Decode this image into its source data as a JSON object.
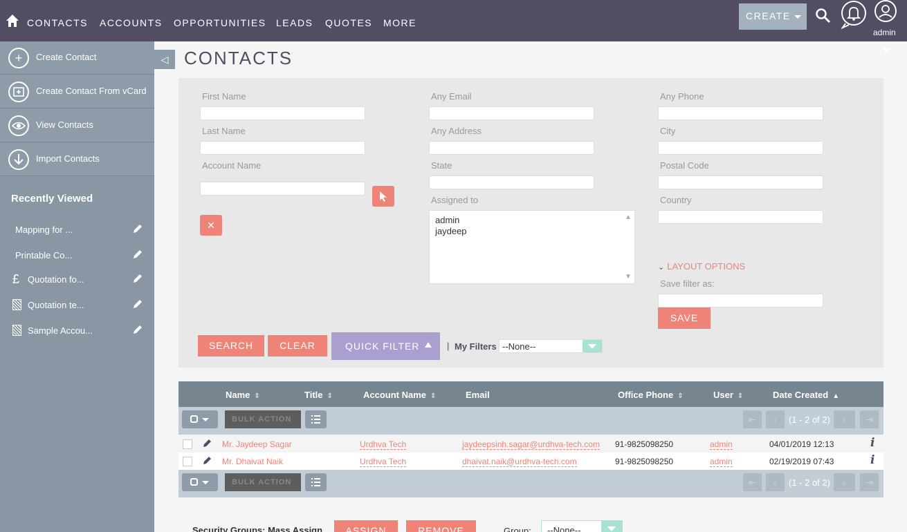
{
  "topnav": {
    "items": [
      "CONTACTS",
      "ACCOUNTS",
      "OPPORTUNITIES",
      "LEADS",
      "QUOTES",
      "MORE"
    ],
    "create_label": "CREATE",
    "user_label": "admin"
  },
  "sidebar": {
    "actions": [
      {
        "label": "Create Contact",
        "icon": "plus-circle-icon"
      },
      {
        "label": "Create Contact From vCard",
        "icon": "vcard-icon"
      },
      {
        "label": "View Contacts",
        "icon": "eye-icon"
      },
      {
        "label": "Import Contacts",
        "icon": "download-icon"
      }
    ],
    "recent_title": "Recently Viewed",
    "recent_items": [
      {
        "label": "Mapping for ...",
        "icon": "none"
      },
      {
        "label": "Printable Co...",
        "icon": "none"
      },
      {
        "label": "Quotation fo...",
        "icon": "pound-icon"
      },
      {
        "label": "Quotation te...",
        "icon": "document-icon"
      },
      {
        "label": "Sample Accou...",
        "icon": "document-icon"
      }
    ]
  },
  "page": {
    "title": "CONTACTS"
  },
  "filter": {
    "labels": {
      "first_name": "First Name",
      "last_name": "Last Name",
      "account_name": "Account Name",
      "any_email": "Any Email",
      "any_address": "Any Address",
      "state": "State",
      "assigned_to": "Assigned to",
      "any_phone": "Any Phone",
      "city": "City",
      "postal_code": "Postal Code",
      "country": "Country",
      "save_filter_as": "Save filter as:"
    },
    "assigned_options": [
      "admin",
      "jaydeep"
    ],
    "layout_options": "LAYOUT OPTIONS",
    "save_label": "SAVE",
    "search_label": "SEARCH",
    "clear_label": "CLEAR",
    "quick_filter_label": "QUICK FILTER",
    "separator": "|",
    "my_filters_label": "My Filters",
    "my_filters_value": "--None--"
  },
  "list": {
    "columns": [
      "Name",
      "Title",
      "Account Name",
      "Email",
      "Office Phone",
      "User",
      "Date Created"
    ],
    "bulk_action": "BULK ACTION",
    "pagination": "(1 - 2 of 2)",
    "rows": [
      {
        "name": "Mr. Jaydeep Sagar",
        "account": "Urdhva Tech",
        "email": "jaydeepsinh.sagar@urdhva-tech.com",
        "phone": "91-9825098250",
        "user": "admin",
        "date": "04/01/2019 12:13"
      },
      {
        "name": "Mr. Dhaivat Naik",
        "account": "Urdhva Tech",
        "email": "dhaivat.naik@urdhva-tech.com",
        "phone": "91-9825098250",
        "user": "admin",
        "date": "02/19/2019 07:43"
      }
    ]
  },
  "mass_assign": {
    "label": "Security Groups: Mass Assign",
    "assign_label": "ASSIGN",
    "remove_label": "REMOVE",
    "group_label": "Group:",
    "group_value": "--None--"
  },
  "colors": {
    "nav_bg": "#534d64",
    "sidebar_bg": "#8996a4",
    "accent": "#f08377",
    "quick_filter": "#ab9fd0",
    "table_header": "#778591"
  }
}
